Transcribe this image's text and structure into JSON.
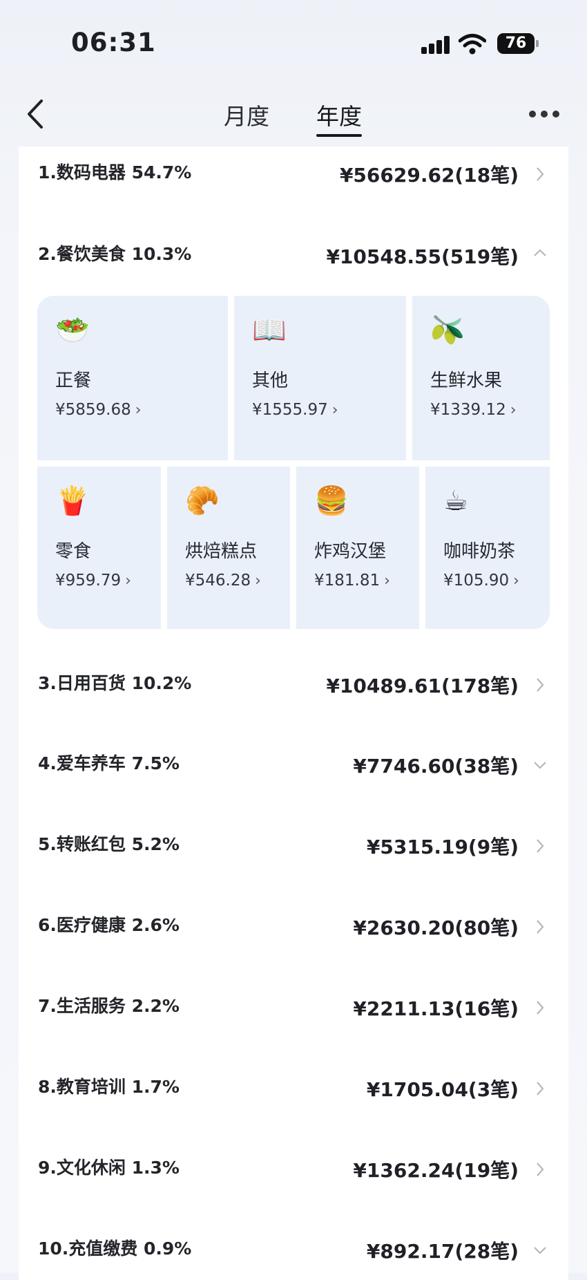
{
  "status": {
    "time": "06:31",
    "battery": "76"
  },
  "nav": {
    "tab_month": "月度",
    "tab_year": "年度",
    "active_tab": "年度"
  },
  "categories": [
    {
      "name": "1.数码电器 54.7%",
      "amount": "¥56629.62(18笔)",
      "chevron": "right"
    },
    {
      "name": "2.餐饮美食 10.3%",
      "amount": "¥10548.55(519笔)",
      "chevron": "up"
    },
    {
      "name": "3.日用百货 10.2%",
      "amount": "¥10489.61(178笔)",
      "chevron": "right"
    },
    {
      "name": "4.爱车养车 7.5%",
      "amount": "¥7746.60(38笔)",
      "chevron": "down"
    },
    {
      "name": "5.转账红包 5.2%",
      "amount": "¥5315.19(9笔)",
      "chevron": "right"
    },
    {
      "name": "6.医疗健康 2.6%",
      "amount": "¥2630.20(80笔)",
      "chevron": "right"
    },
    {
      "name": "7.生活服务 2.2%",
      "amount": "¥2211.13(16笔)",
      "chevron": "right"
    },
    {
      "name": "8.教育培训 1.7%",
      "amount": "¥1705.04(3笔)",
      "chevron": "right"
    },
    {
      "name": "9.文化休闲 1.3%",
      "amount": "¥1362.24(19笔)",
      "chevron": "right"
    },
    {
      "name": "10.充值缴费 0.9%",
      "amount": "¥892.17(28笔)",
      "chevron": "down"
    }
  ],
  "food_subcategories": [
    {
      "label": "正餐",
      "amount": "¥5859.68",
      "icon": "meal-plate-icon",
      "emoji": "🥗"
    },
    {
      "label": "其他",
      "amount": "¥1555.97",
      "icon": "open-book-icon",
      "emoji": "📖"
    },
    {
      "label": "生鲜水果",
      "amount": "¥1339.12",
      "icon": "green-fruit-icon",
      "emoji": "🫒"
    },
    {
      "label": "零食",
      "amount": "¥959.79",
      "icon": "potato-chips-icon",
      "emoji": "🍟"
    },
    {
      "label": "烘焙糕点",
      "amount": "¥546.28",
      "icon": "bread-icon",
      "emoji": "🥐"
    },
    {
      "label": "炸鸡汉堡",
      "amount": "¥181.81",
      "icon": "burger-icon",
      "emoji": "🍔"
    },
    {
      "label": "咖啡奶茶",
      "amount": "¥105.90",
      "icon": "coffee-cup-icon",
      "emoji": "☕"
    }
  ]
}
